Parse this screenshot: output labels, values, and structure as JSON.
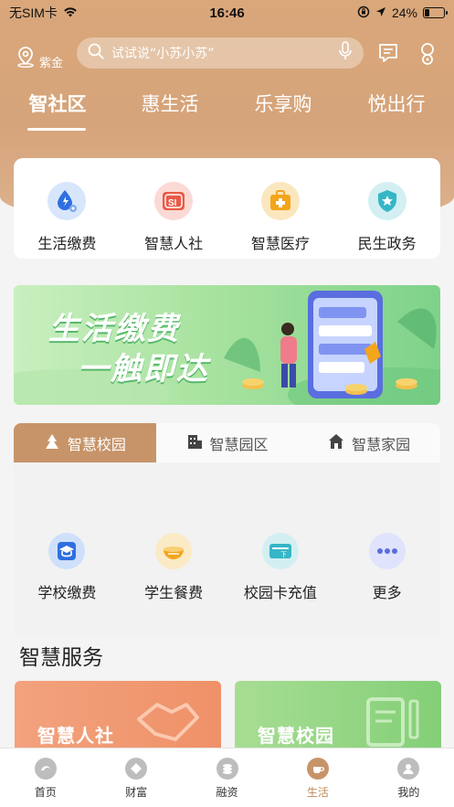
{
  "status": {
    "carrier": "无SIM卡",
    "time": "16:46",
    "battery": "24%",
    "battery_level": 0.24
  },
  "header": {
    "location": "紫金",
    "search_placeholder": "试试说“小苏小苏”"
  },
  "tabs": [
    {
      "label": "智社区",
      "active": true
    },
    {
      "label": "惠生活",
      "active": false
    },
    {
      "label": "乐享购",
      "active": false
    },
    {
      "label": "悦出行",
      "active": false
    }
  ],
  "quick": [
    {
      "label": "生活缴费",
      "icon": "water-drop-gear-icon"
    },
    {
      "label": "智慧人社",
      "icon": "si-card-icon"
    },
    {
      "label": "智慧医疗",
      "icon": "medical-kit-icon"
    },
    {
      "label": "民生政务",
      "icon": "star-shield-icon"
    }
  ],
  "banner": {
    "line1": "生活缴费",
    "line2": "一触即达"
  },
  "campus_tabs": [
    {
      "label": "智慧校园",
      "icon": "campus-icon",
      "active": true
    },
    {
      "label": "智慧园区",
      "icon": "building-icon",
      "active": false
    },
    {
      "label": "智慧家园",
      "icon": "home-icon",
      "active": false
    }
  ],
  "campus_items": [
    {
      "label": "学校缴费",
      "icon": "graduation-cap-icon"
    },
    {
      "label": "学生餐费",
      "icon": "meal-bowl-icon"
    },
    {
      "label": "校园卡充值",
      "icon": "campus-card-icon"
    },
    {
      "label": "更多",
      "icon": "more-dots-icon"
    }
  ],
  "section_title": "智慧服务",
  "services": [
    {
      "label": "智慧人社",
      "icon": "handshake-icon"
    },
    {
      "label": "智慧校园",
      "icon": "book-pencil-icon"
    }
  ],
  "bottom_nav": [
    {
      "label": "首页",
      "icon": "home-logo-icon",
      "active": false
    },
    {
      "label": "财富",
      "icon": "diamond-icon",
      "active": false
    },
    {
      "label": "融资",
      "icon": "coin-stack-icon",
      "active": false
    },
    {
      "label": "生活",
      "icon": "coffee-cup-icon",
      "active": true
    },
    {
      "label": "我的",
      "icon": "user-icon",
      "active": false
    }
  ],
  "colors": {
    "brand": "#c79469",
    "hero": "#d9a77a",
    "banner_green": "#7ed28a"
  }
}
